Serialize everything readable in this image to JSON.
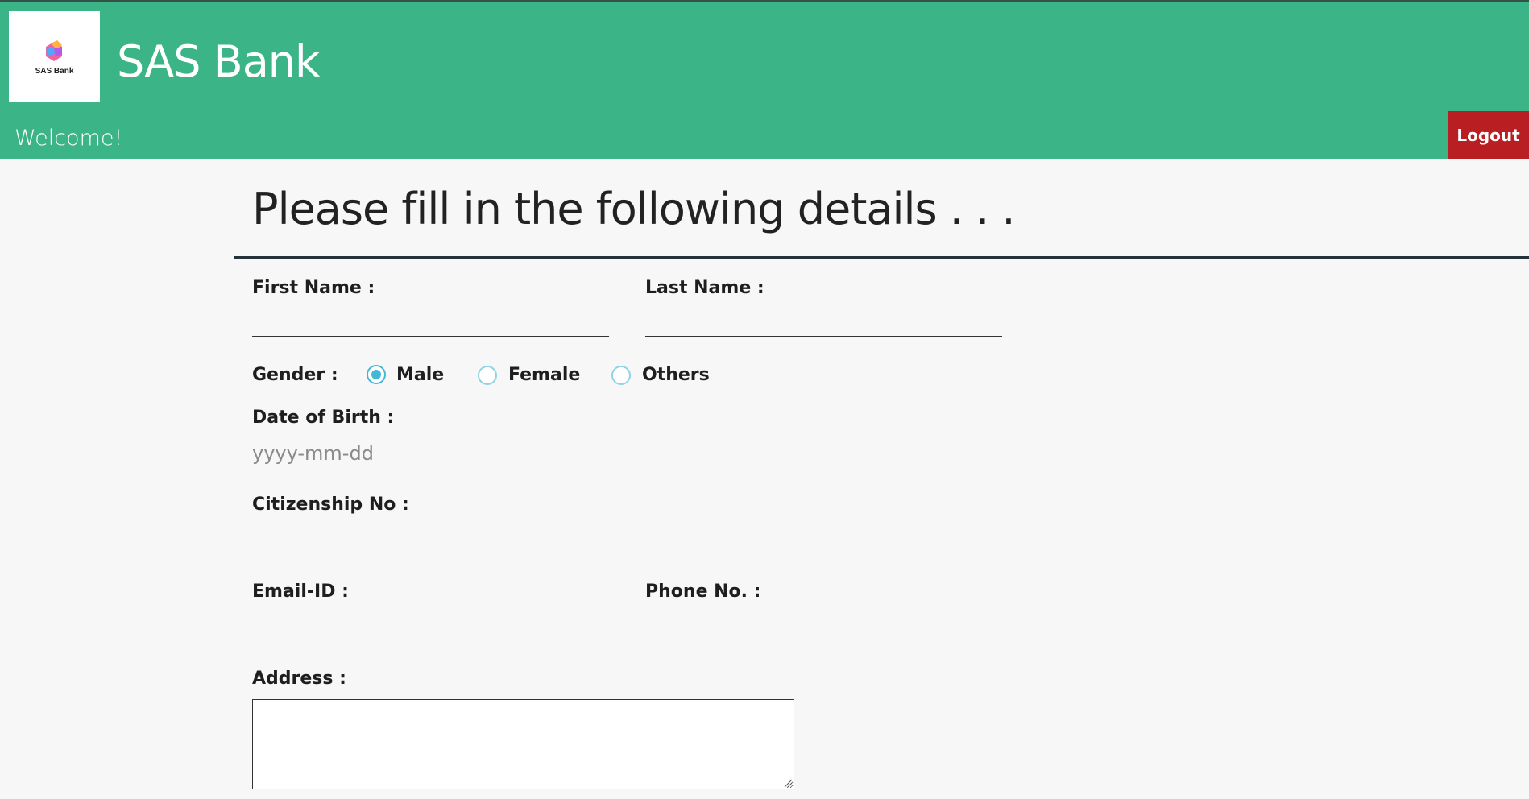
{
  "header": {
    "logo_text": "SAS Bank",
    "brand": "SAS Bank",
    "welcome": "Welcome!",
    "logout_label": "Logout",
    "colors": {
      "header_bg": "#3bb487",
      "logout_bg": "#b91f22"
    }
  },
  "form": {
    "title": "Please fill in the following details . . .",
    "first_name_label": "First Name :",
    "last_name_label": "Last Name :",
    "gender_label": "Gender :",
    "gender_options": [
      "Male",
      "Female",
      "Others"
    ],
    "gender_selected": "Male",
    "dob_label": "Date of Birth :",
    "dob_placeholder": "yyyy-mm-dd",
    "citizenship_label": "Citizenship No :",
    "email_label": "Email-ID :",
    "phone_label": "Phone No. :",
    "address_label": "Address :"
  },
  "icons": [
    "logo-icon",
    "radio-icon",
    "resize-handle-icon"
  ]
}
